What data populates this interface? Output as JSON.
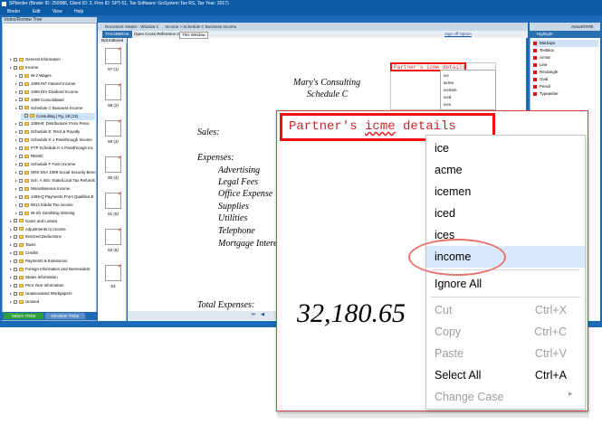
{
  "window": {
    "title": "SPbinder (Binder ID: 250086, Client ID: 3, Firm ID: SPT-51, Tax Software: GoSystem Tax RS, Tax Year: 2017)",
    "menus": [
      "Binder",
      "Edit",
      "View",
      "Help"
    ]
  },
  "tree": {
    "header": "Index/Review Tree",
    "rows": [
      {
        "label": "General Information",
        "indent": 1
      },
      {
        "label": "Income",
        "indent": 1
      },
      {
        "label": "W-2 Wages",
        "indent": 2
      },
      {
        "label": "1099 INT Interest Income",
        "indent": 2
      },
      {
        "label": "1099 DIV Dividend Income",
        "indent": 2
      },
      {
        "label": "1099 Consolidated",
        "indent": 2
      },
      {
        "label": "Schedule C Business Income",
        "indent": 2
      },
      {
        "label": "Consulting | Pg. 28 (13)",
        "indent": 3
      },
      {
        "label": "1099-B: Distributions From Pensi",
        "indent": 2
      },
      {
        "label": "Schedule E: Rent & Royalty",
        "indent": 2
      },
      {
        "label": "Schedule K-1 Passthrough Income",
        "indent": 2
      },
      {
        "label": "PTP Schedule K-1 Passthrough Inc",
        "indent": 2
      },
      {
        "label": "REMIC",
        "indent": 2
      },
      {
        "label": "Schedule F Farm Income",
        "indent": 2
      },
      {
        "label": "SRS-SSA 1099 Social Security Bene",
        "indent": 2
      },
      {
        "label": "Sch. A Info: State/Local Tax Refunds",
        "indent": 2
      },
      {
        "label": "Miscellaneous Income",
        "indent": 2
      },
      {
        "label": "1099-Q Payments From Qualified E",
        "indent": 2
      },
      {
        "label": "8814 Kiddie Tax Income",
        "indent": 2
      },
      {
        "label": "W-2G Gambling Winning",
        "indent": 2
      },
      {
        "label": "Gains and Losses",
        "indent": 1
      },
      {
        "label": "Adjustments to Income",
        "indent": 1
      },
      {
        "label": "Itemized Deductions",
        "indent": 1
      },
      {
        "label": "Taxes",
        "indent": 1
      },
      {
        "label": "Credits",
        "indent": 1
      },
      {
        "label": "Payments & Extensions",
        "indent": 1
      },
      {
        "label": "Foreign Information and Nonresident",
        "indent": 1
      },
      {
        "label": "States Information",
        "indent": 1
      },
      {
        "label": "Prior Year Information",
        "indent": 1
      },
      {
        "label": "Unassociated Workpapers",
        "indent": 1
      },
      {
        "label": "Unused",
        "indent": 1
      }
    ],
    "tabs": [
      "INDEX TREE",
      "REVIEW TREE"
    ]
  },
  "thumbs": {
    "label": "Not Indexed",
    "items": [
      "57 (1)",
      "58 (2)",
      "59 (3)",
      "60 (4)",
      "61 (5)",
      "62 (6)",
      "63"
    ]
  },
  "viewer": {
    "header": "Document Viewer - Window 1",
    "breadcrumb": "Income > Schedule C Business Income",
    "toolbar_title": "TAXABBRAK",
    "open_label": "Open Cross Reference In:",
    "open_value": "This Window",
    "signoff": "Sign off Option",
    "doc": {
      "title1": "Mary's Consulting",
      "title2": "Schedule C",
      "sales": "Sales:",
      "expenses": "Expenses:",
      "lines": [
        "Advertising",
        "Legal Fees",
        "Office Expense",
        "Supplies",
        "Utilities",
        "Telephone",
        "Mortgage Interest"
      ],
      "total": "Total Expenses:"
    }
  },
  "tools": {
    "header": "AnnoSTATE",
    "top": "Highlight",
    "items": [
      "Markups",
      "TextBox",
      "Arrow",
      "Line",
      "Rectangle",
      "Oval",
      "Pencil",
      "Typewriter"
    ]
  },
  "mini_popup": {
    "text": "Partner's icme details",
    "items": [
      "ice",
      "acme",
      "icemen",
      "iced",
      "ices"
    ]
  },
  "zoom": {
    "text_before": "Partner's ",
    "text_err": "icme",
    "text_after": " details",
    "number": "32,180.65"
  },
  "context_menu": {
    "suggestions": [
      "ice",
      "acme",
      "icemen",
      "iced",
      "ices",
      "income"
    ],
    "ignore_all": "Ignore All",
    "cut": "Cut",
    "cut_sc": "Ctrl+X",
    "copy": "Copy",
    "copy_sc": "Ctrl+C",
    "paste": "Paste",
    "paste_sc": "Ctrl+V",
    "select_all": "Select All",
    "select_all_sc": "Ctrl+A",
    "change_case": "Change Case",
    "colors": {
      "highlight": "#d9e9fb",
      "annotation": "#e9746c",
      "disabled": "#9d9d9d"
    }
  }
}
